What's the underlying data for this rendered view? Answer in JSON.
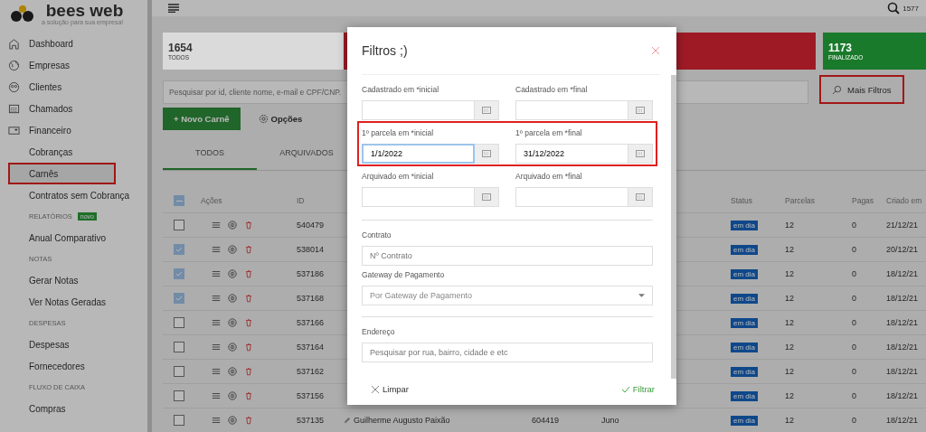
{
  "brand": {
    "name": "bees web",
    "tagline": "a solução para sua empresa!"
  },
  "header": {
    "count": "1577"
  },
  "sidebar": {
    "items": [
      {
        "kind": "main",
        "label": "Dashboard",
        "selected": false,
        "highlighted": false
      },
      {
        "kind": "main",
        "label": "Empresas",
        "selected": false,
        "highlighted": false
      },
      {
        "kind": "main",
        "label": "Clientes",
        "selected": false,
        "highlighted": false
      },
      {
        "kind": "main",
        "label": "Chamados",
        "selected": false,
        "highlighted": false
      },
      {
        "kind": "main",
        "label": "Financeiro",
        "selected": false,
        "highlighted": false
      },
      {
        "kind": "sub",
        "label": "Cobranças",
        "selected": false,
        "highlighted": false
      },
      {
        "kind": "sub",
        "label": "Carnês",
        "selected": true,
        "highlighted": true
      },
      {
        "kind": "sub",
        "label": "Contratos sem Cobrança",
        "selected": false,
        "highlighted": false
      },
      {
        "kind": "section",
        "label": "RELATÓRIOS",
        "badge": "novo"
      },
      {
        "kind": "sub",
        "label": "Anual Comparativo",
        "selected": false,
        "highlighted": false
      },
      {
        "kind": "section",
        "label": "NOTAS"
      },
      {
        "kind": "sub",
        "label": "Gerar Notas",
        "selected": false,
        "highlighted": false
      },
      {
        "kind": "sub",
        "label": "Ver Notas Geradas",
        "selected": false,
        "highlighted": false
      },
      {
        "kind": "section",
        "label": "DESPESAS"
      },
      {
        "kind": "sub",
        "label": "Despesas",
        "selected": false,
        "highlighted": false
      },
      {
        "kind": "sub",
        "label": "Fornecedores",
        "selected": false,
        "highlighted": false
      },
      {
        "kind": "section",
        "label": "FLUXO DE CAIXA"
      },
      {
        "kind": "sub",
        "label": "Compras",
        "selected": false,
        "highlighted": false
      }
    ]
  },
  "stats": [
    {
      "value": "1654",
      "label": "TODOS",
      "color": "#dadada"
    },
    {
      "color": "#9e1b26"
    },
    {
      "value": "1173",
      "label": "FINALIZADO",
      "color": "#1a7a2b"
    }
  ],
  "search": {
    "placeholder": "Pesquisar por id, cliente nome, e-mail e CPF/CNP."
  },
  "more_filters": {
    "label": "Mais Filtros",
    "highlighted": true
  },
  "actions": {
    "new": "+ Novo Carnê",
    "options": "Opções"
  },
  "tabs": [
    {
      "label": "TODOS",
      "selected": true
    },
    {
      "label": "ARQUIVADOS",
      "selected": false
    }
  ],
  "table": {
    "select_all": true,
    "columns": [
      "Ações",
      "ID",
      "Status",
      "Parcelas",
      "Pagas",
      "Criado em"
    ],
    "rows": [
      {
        "checked": false,
        "id": "540479",
        "status": "em dia",
        "parcelas": "12",
        "pagas": "0",
        "criado": "21/12/21"
      },
      {
        "checked": true,
        "id": "538014",
        "status": "em dia",
        "parcelas": "12",
        "pagas": "0",
        "criado": "20/12/21"
      },
      {
        "checked": true,
        "id": "537186",
        "status": "em dia",
        "parcelas": "12",
        "pagas": "0",
        "criado": "18/12/21"
      },
      {
        "checked": true,
        "id": "537168",
        "status": "em dia",
        "parcelas": "12",
        "pagas": "0",
        "criado": "18/12/21"
      },
      {
        "checked": false,
        "id": "537166",
        "status": "em dia",
        "parcelas": "12",
        "pagas": "0",
        "criado": "18/12/21"
      },
      {
        "checked": false,
        "id": "537164",
        "status": "em dia",
        "parcelas": "12",
        "pagas": "0",
        "criado": "18/12/21"
      },
      {
        "checked": false,
        "id": "537162",
        "status": "em dia",
        "parcelas": "12",
        "pagas": "0",
        "criado": "18/12/21"
      },
      {
        "checked": false,
        "id": "537156",
        "status": "em dia",
        "parcelas": "12",
        "pagas": "0",
        "criado": "18/12/21"
      },
      {
        "checked": false,
        "id": "537135",
        "column_4": "Guilherme Augusto Paixão",
        "column_5": "604419",
        "column_6": "Juno",
        "status": "em dia",
        "parcelas": "12",
        "pagas": "0",
        "criado": "18/12/21"
      }
    ]
  },
  "modal": {
    "title": "Filtros ;)",
    "date_rows": [
      {
        "highlighted": false,
        "fields": [
          {
            "label": "Cadastrado em *inicial",
            "focused": false
          },
          {
            "label": "Cadastrado em *final",
            "focused": false
          }
        ]
      },
      {
        "highlighted": true,
        "fields": [
          {
            "label": "1º parcela em *inicial",
            "value": "1/1/2022",
            "focused": true
          },
          {
            "label": "1º parcela em *final",
            "value": "31/12/2022",
            "focused": false
          }
        ]
      },
      {
        "highlighted": false,
        "fields": [
          {
            "label": "Arquivado em *inicial",
            "focused": false
          },
          {
            "label": "Arquivado em *final",
            "focused": false
          }
        ]
      }
    ],
    "contract": {
      "label": "Contrato",
      "placeholder": "Nº Contrato"
    },
    "gateway": {
      "label": "Gateway de Pagamento",
      "placeholder": "Por Gateway de Pagamento"
    },
    "address": {
      "label": "Endereço",
      "placeholder": "Pesquisar por rua, bairro, cidade e etc"
    },
    "clear": "Limpar",
    "apply": "Filtrar"
  }
}
